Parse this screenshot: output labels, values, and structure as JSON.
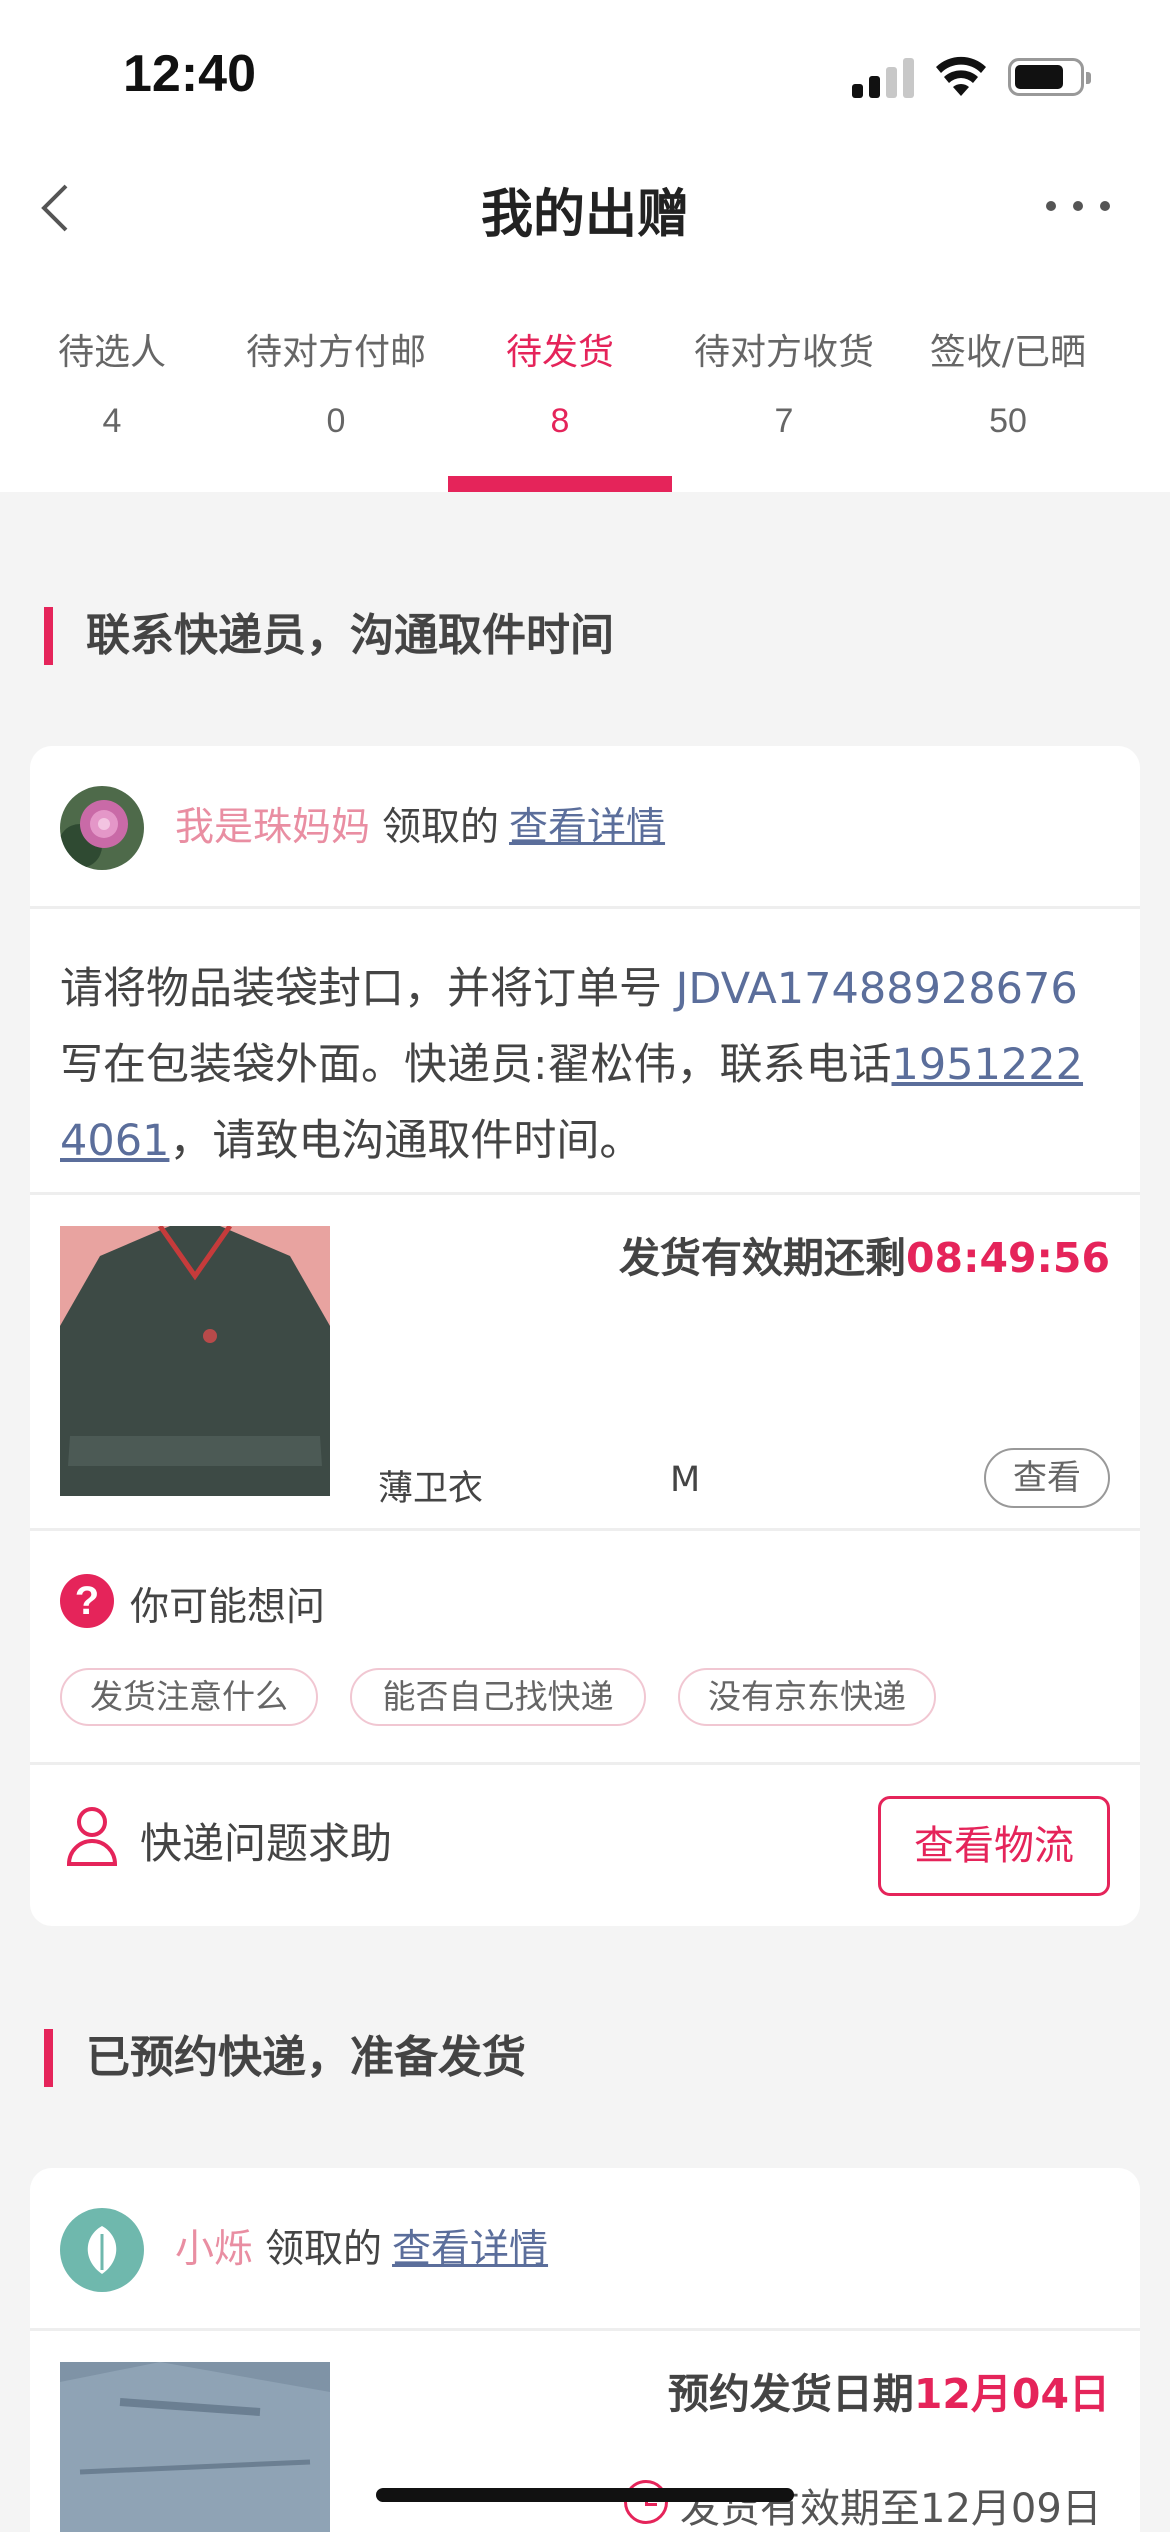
{
  "status_bar": {
    "time": "12:40"
  },
  "header": {
    "title": "我的出赠"
  },
  "tabs": [
    {
      "label": "待选人",
      "count": "4"
    },
    {
      "label": "待对方付邮",
      "count": "0"
    },
    {
      "label": "待发货",
      "count": "8",
      "active": true
    },
    {
      "label": "待对方收货",
      "count": "7"
    },
    {
      "label": "签收/已晒",
      "count": "50"
    }
  ],
  "section1": {
    "title": "联系快递员，沟通取件时间",
    "card": {
      "receiver_name": "我是珠妈妈",
      "receiver_verb": "领取的",
      "detail_link": "查看详情",
      "instruction_pre": "请将物品装袋封口，并将订单号",
      "order_number": "JDVA17488928676",
      "instruction_mid": "写在包装袋外面。快递员:翟松伟，联系电话",
      "phone": "19512224061",
      "instruction_post": "，请致电沟通取件时间。",
      "deadline_label": "发货有效期还剩",
      "deadline_value": "08:49:56",
      "item_name": "薄卫衣",
      "item_size": "M",
      "view_button": "查看",
      "faq_title": "你可能想问",
      "faq_chips": [
        "发货注意什么",
        "能否自己找快递",
        "没有京东快递"
      ],
      "help_label": "快递问题求助",
      "logistics_button": "查看物流"
    }
  },
  "section2": {
    "title": "已预约快递，准备发货",
    "card": {
      "receiver_name": "小烁",
      "receiver_verb": "领取的",
      "detail_link": "查看详情",
      "ship_date_label": "预约发货日期",
      "ship_date_value": "12月04日",
      "valid_until": "发货有效期至12月09日"
    }
  },
  "colors": {
    "accent": "#e5245a",
    "link": "#5b6e9b",
    "name": "#e98ea2"
  }
}
